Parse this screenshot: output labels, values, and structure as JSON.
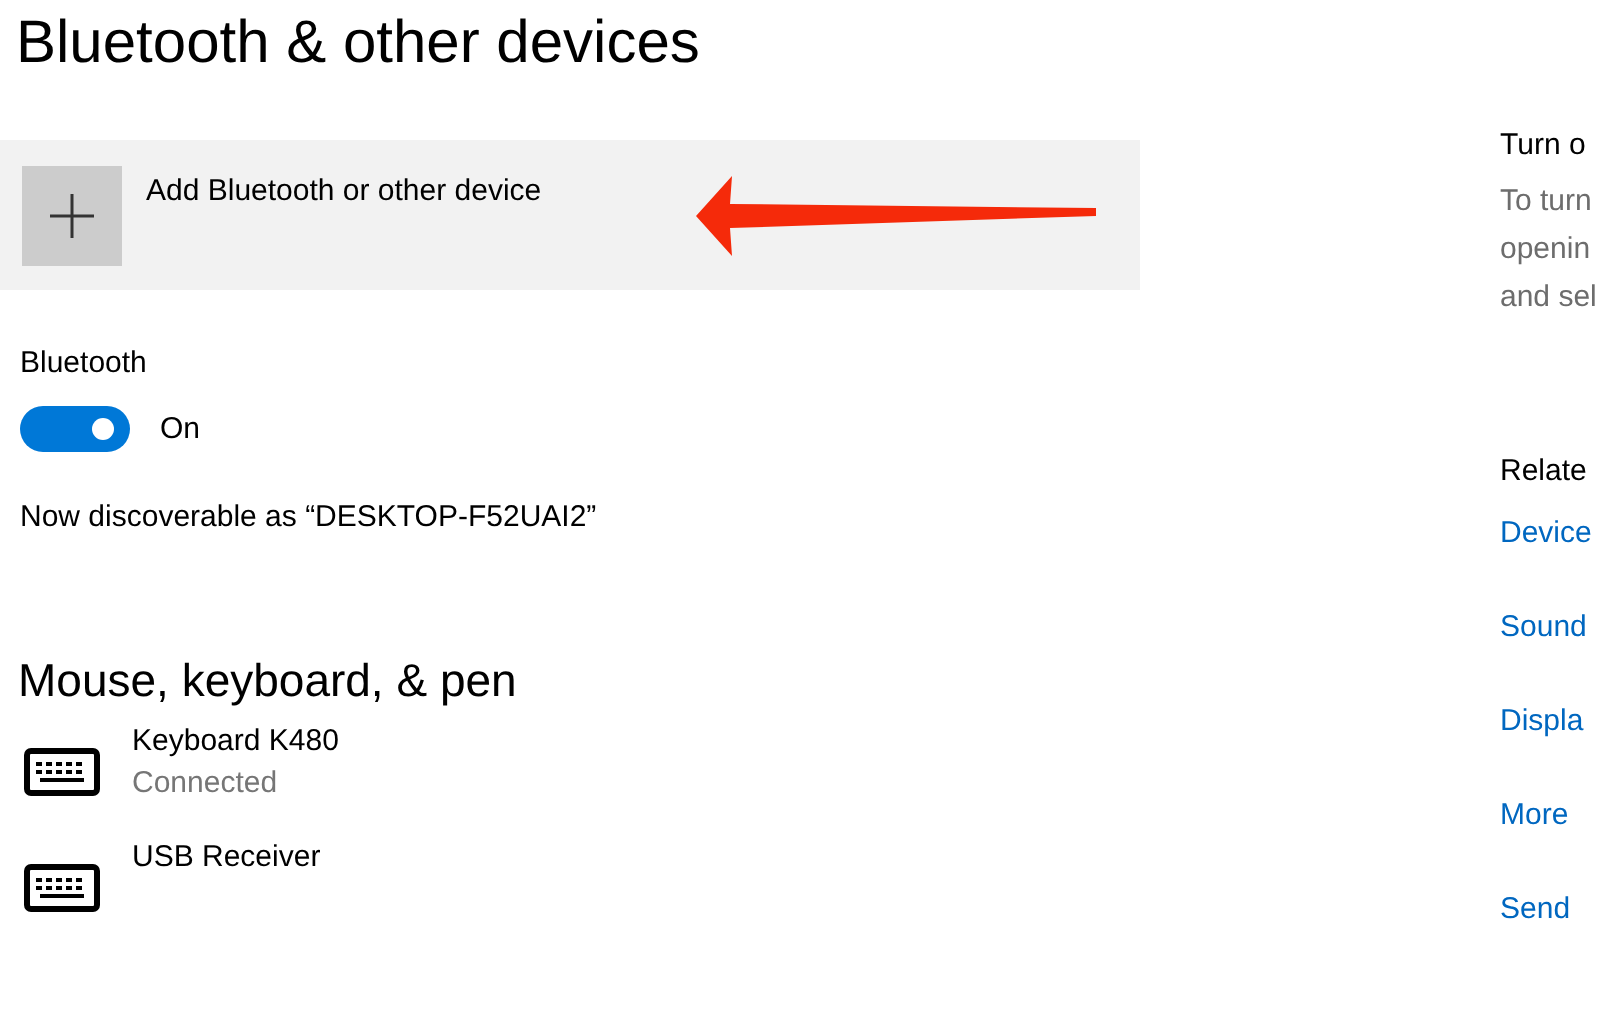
{
  "title": "Bluetooth & other devices",
  "add_device": {
    "label": "Add Bluetooth or other device"
  },
  "bluetooth": {
    "label": "Bluetooth",
    "on": true,
    "state_text": "On",
    "discoverable": "Now discoverable as “DESKTOP-F52UAI2”"
  },
  "devices_section": {
    "heading": "Mouse, keyboard, & pen",
    "devices": [
      {
        "name": "Keyboard K480",
        "status": "Connected"
      },
      {
        "name": "USB Receiver"
      }
    ]
  },
  "side": {
    "heading": "Turn o",
    "description_lines": [
      "To turn",
      "openin",
      "and sel"
    ],
    "related_heading": "Relate",
    "links": [
      "Device",
      "Sound",
      "Displa",
      "More",
      "Send"
    ]
  }
}
